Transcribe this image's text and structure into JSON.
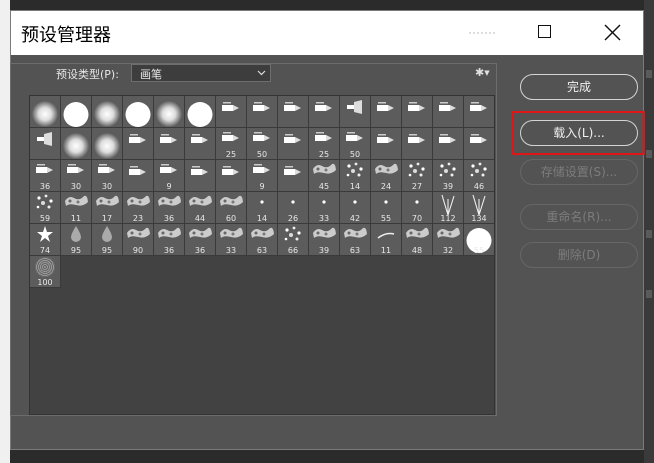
{
  "window": {
    "title": "预设管理器",
    "maximize_icon": "maximize-icon",
    "close_icon": "close-icon"
  },
  "preset_type": {
    "label": "预设类型(P):",
    "value": "画笔"
  },
  "settings_icon": "gear-icon",
  "buttons": {
    "done": "完成",
    "load": "载入(L)...",
    "save_set": "存储设置(S)...",
    "rename": "重命名(R)...",
    "delete": "删除(D)"
  },
  "colors": {
    "highlight": "#e01515",
    "dialog_bg": "#535353",
    "cell_bg": "#5c5c5c"
  },
  "brush_presets": [
    {
      "kind": "soft",
      "size": ""
    },
    {
      "kind": "hard",
      "size": ""
    },
    {
      "kind": "soft",
      "size": ""
    },
    {
      "kind": "hard",
      "size": ""
    },
    {
      "kind": "soft",
      "size": ""
    },
    {
      "kind": "hard",
      "size": ""
    },
    {
      "kind": "tip",
      "size": ""
    },
    {
      "kind": "tip",
      "size": ""
    },
    {
      "kind": "tip",
      "size": ""
    },
    {
      "kind": "tip",
      "size": ""
    },
    {
      "kind": "fan",
      "size": ""
    },
    {
      "kind": "tip",
      "size": ""
    },
    {
      "kind": "tip",
      "size": ""
    },
    {
      "kind": "tip",
      "size": ""
    },
    {
      "kind": "tip",
      "size": ""
    },
    {
      "kind": "fan",
      "size": ""
    },
    {
      "kind": "soft",
      "size": ""
    },
    {
      "kind": "soft",
      "size": ""
    },
    {
      "kind": "tip",
      "size": ""
    },
    {
      "kind": "tip",
      "size": ""
    },
    {
      "kind": "tip",
      "size": ""
    },
    {
      "kind": "tip",
      "size": "25"
    },
    {
      "kind": "tip",
      "size": "50"
    },
    {
      "kind": "tip",
      "size": ""
    },
    {
      "kind": "tip",
      "size": "25"
    },
    {
      "kind": "tip",
      "size": "50"
    },
    {
      "kind": "tip",
      "size": ""
    },
    {
      "kind": "tip",
      "size": ""
    },
    {
      "kind": "tip",
      "size": ""
    },
    {
      "kind": "tip",
      "size": ""
    },
    {
      "kind": "tip",
      "size": "36"
    },
    {
      "kind": "tip",
      "size": "30"
    },
    {
      "kind": "tip",
      "size": "30"
    },
    {
      "kind": "tip",
      "size": ""
    },
    {
      "kind": "tip",
      "size": "9"
    },
    {
      "kind": "tip",
      "size": ""
    },
    {
      "kind": "tip",
      "size": ""
    },
    {
      "kind": "tip",
      "size": "9"
    },
    {
      "kind": "tip",
      "size": ""
    },
    {
      "kind": "texture",
      "size": "45"
    },
    {
      "kind": "scatter",
      "size": "14"
    },
    {
      "kind": "texture",
      "size": "24"
    },
    {
      "kind": "scatter",
      "size": "27"
    },
    {
      "kind": "scatter",
      "size": "39"
    },
    {
      "kind": "scatter",
      "size": "46"
    },
    {
      "kind": "scatter",
      "size": "59"
    },
    {
      "kind": "texture",
      "size": "11"
    },
    {
      "kind": "texture",
      "size": "17"
    },
    {
      "kind": "texture",
      "size": "23"
    },
    {
      "kind": "texture",
      "size": "36"
    },
    {
      "kind": "texture",
      "size": "44"
    },
    {
      "kind": "texture",
      "size": "60"
    },
    {
      "kind": "dot",
      "size": "14"
    },
    {
      "kind": "dot",
      "size": "26"
    },
    {
      "kind": "dot",
      "size": "33"
    },
    {
      "kind": "dot",
      "size": "42"
    },
    {
      "kind": "dot",
      "size": "55"
    },
    {
      "kind": "dot",
      "size": "70"
    },
    {
      "kind": "grass",
      "size": "112"
    },
    {
      "kind": "grass",
      "size": "134"
    },
    {
      "kind": "star",
      "size": "74"
    },
    {
      "kind": "drop",
      "size": "95"
    },
    {
      "kind": "drop",
      "size": "95"
    },
    {
      "kind": "texture",
      "size": "90"
    },
    {
      "kind": "texture",
      "size": "36"
    },
    {
      "kind": "texture",
      "size": "36"
    },
    {
      "kind": "texture",
      "size": "33"
    },
    {
      "kind": "texture",
      "size": "63"
    },
    {
      "kind": "scatter",
      "size": "66"
    },
    {
      "kind": "texture",
      "size": "39"
    },
    {
      "kind": "texture",
      "size": "63"
    },
    {
      "kind": "streak",
      "size": "11"
    },
    {
      "kind": "texture",
      "size": "48"
    },
    {
      "kind": "texture",
      "size": "32"
    },
    {
      "kind": "hard",
      "size": "55"
    },
    {
      "kind": "noise",
      "size": "100"
    }
  ]
}
